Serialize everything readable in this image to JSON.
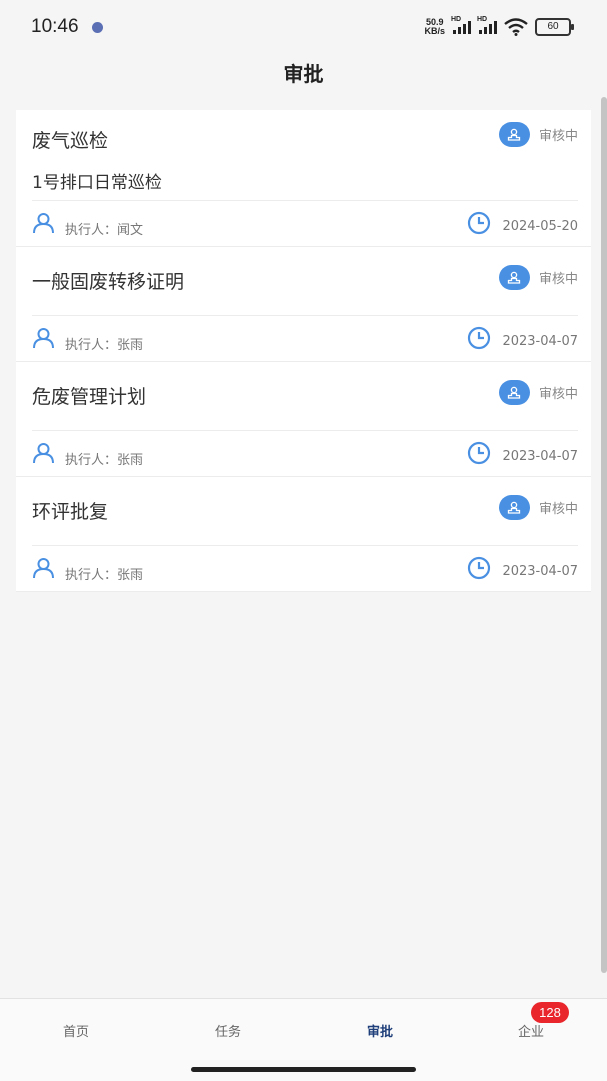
{
  "status_bar": {
    "time": "10:46",
    "net_speed_value": "50.9",
    "net_speed_unit": "KB/s",
    "signal_label": "HD",
    "battery": "60"
  },
  "header": {
    "title": "审批"
  },
  "cards": [
    {
      "title": "废气巡检",
      "subtitle": "1号排口日常巡检",
      "status": "审核中",
      "executor_label": "执行人：",
      "executor": "闻文",
      "date": "2024-05-20"
    },
    {
      "title": "一般固废转移证明",
      "status": "审核中",
      "executor_label": "执行人：",
      "executor": "张雨",
      "date": "2023-04-07"
    },
    {
      "title": "危废管理计划",
      "status": "审核中",
      "executor_label": "执行人：",
      "executor": "张雨",
      "date": "2023-04-07"
    },
    {
      "title": "环评批复",
      "status": "审核中",
      "executor_label": "执行人：",
      "executor": "张雨",
      "date": "2023-04-07"
    }
  ],
  "tabbar": {
    "tabs": [
      "首页",
      "任务",
      "审批",
      "企业"
    ],
    "active": "审批",
    "badge": "128"
  },
  "colors": {
    "accent": "#4a90e2",
    "active_tab": "#1f3f7a",
    "badge": "#e8262b"
  },
  "icons": {
    "status": "stamp-icon",
    "executor": "person-icon",
    "date": "clock-icon"
  }
}
